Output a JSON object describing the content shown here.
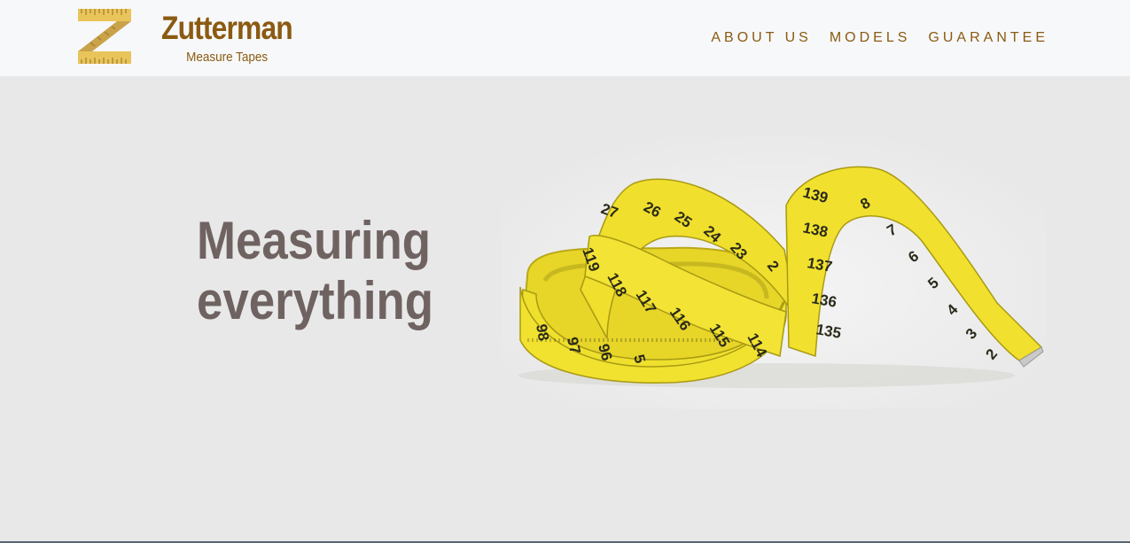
{
  "brand": {
    "logo_icon": "ruler-z-logo-icon",
    "name": "Zutterman",
    "tagline": "Measure Tapes"
  },
  "nav": {
    "items": [
      {
        "label": "ABOUT US"
      },
      {
        "label": "MODELS"
      },
      {
        "label": "GUARANTEE"
      }
    ]
  },
  "hero": {
    "heading_line1": "Measuring",
    "heading_line2": "everything",
    "image_icon": "measuring-tape-photo",
    "tape_numbers": [
      "27",
      "26",
      "25",
      "24",
      "23",
      "2",
      "119",
      "118",
      "117",
      "116",
      "115",
      "114",
      "98",
      "97",
      "96",
      "5",
      "139",
      "138",
      "137",
      "136",
      "135",
      "8",
      "7",
      "6",
      "5",
      "4",
      "3",
      "2"
    ]
  },
  "colors": {
    "brand": "#8b5a12",
    "heading": "#6f6362",
    "tape_yellow": "#f2e230",
    "hero_bg": "#e8e8e8",
    "navbar_bg": "#f7f8f9"
  }
}
